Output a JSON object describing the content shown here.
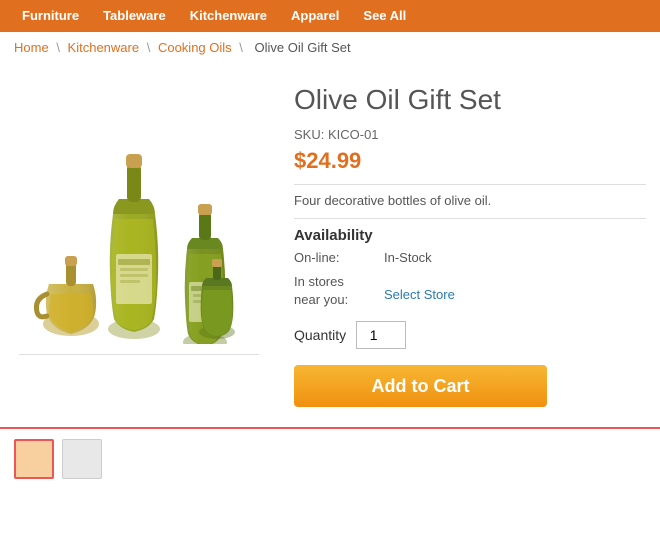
{
  "nav": {
    "items": [
      {
        "label": "Furniture",
        "href": "#"
      },
      {
        "label": "Tableware",
        "href": "#"
      },
      {
        "label": "Kitchenware",
        "href": "#"
      },
      {
        "label": "Apparel",
        "href": "#"
      },
      {
        "label": "See All",
        "href": "#"
      }
    ]
  },
  "breadcrumb": {
    "items": [
      {
        "label": "Home",
        "href": "#"
      },
      {
        "label": "Kitchenware",
        "href": "#"
      },
      {
        "label": "Cooking Oils",
        "href": "#"
      },
      {
        "label": "Olive Oil Gift Set",
        "href": null
      }
    ]
  },
  "product": {
    "title": "Olive Oil Gift Set",
    "sku_label": "SKU:",
    "sku": "KICO-01",
    "price": "$24.99",
    "description": "Four decorative bottles of olive oil.",
    "availability_title": "Availability",
    "online_label": "On-line:",
    "online_value": "In-Stock",
    "stores_label": "In stores\nnear you:",
    "select_store_label": "Select Store",
    "quantity_label": "Quantity",
    "quantity_value": "1",
    "add_to_cart_label": "Add to Cart"
  },
  "colors": {
    "nav_bg": "#e07020",
    "price": "#e07020",
    "add_to_cart_bg": "#f5a623",
    "select_store": "#2a7ab0",
    "thumb_border": "#e55"
  }
}
